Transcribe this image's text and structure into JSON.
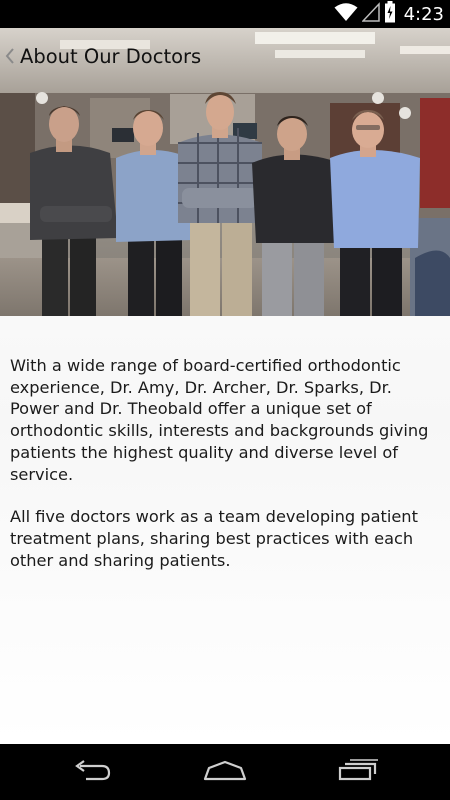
{
  "status_bar": {
    "time": "4:23",
    "icons": [
      "wifi-icon",
      "cell-signal-icon",
      "battery-icon"
    ]
  },
  "action_bar": {
    "title": "About Our Doctors",
    "back_icon": "chevron-left-icon"
  },
  "hero_image": {
    "subject": "Five doctors standing in an orthodontic office"
  },
  "body": {
    "paragraphs": [
      "With a wide range of board-certified orthodontic experience, Dr. Amy, Dr. Archer, Dr. Sparks, Dr. Power and Dr. Theobald offer a unique set of orthodontic skills, interests and backgrounds giving patients the highest quality and diverse level of service.",
      "All five doctors work as a team developing patient treatment plans, sharing best practices with each other and sharing patients."
    ]
  },
  "nav_bar": {
    "buttons": [
      "back-nav-icon",
      "home-nav-icon",
      "recents-nav-icon"
    ]
  },
  "colors": {
    "status_bar_bg": "#000000",
    "nav_bar_bg": "#000000",
    "text": "#1b1b1b",
    "background": "#ffffff"
  }
}
